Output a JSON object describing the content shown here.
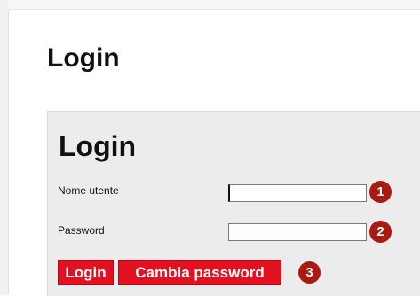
{
  "page": {
    "title": "Login"
  },
  "login_panel": {
    "title": "Login",
    "username_label": "Nome utente",
    "username_value": "",
    "password_label": "Password",
    "password_value": "",
    "login_button": "Login",
    "change_password_button": "Cambia password"
  },
  "callouts": [
    "1",
    "2",
    "3"
  ],
  "colors": {
    "button_red": "#e3101f",
    "callout_red": "#a81a12",
    "panel_bg": "#ececec"
  }
}
